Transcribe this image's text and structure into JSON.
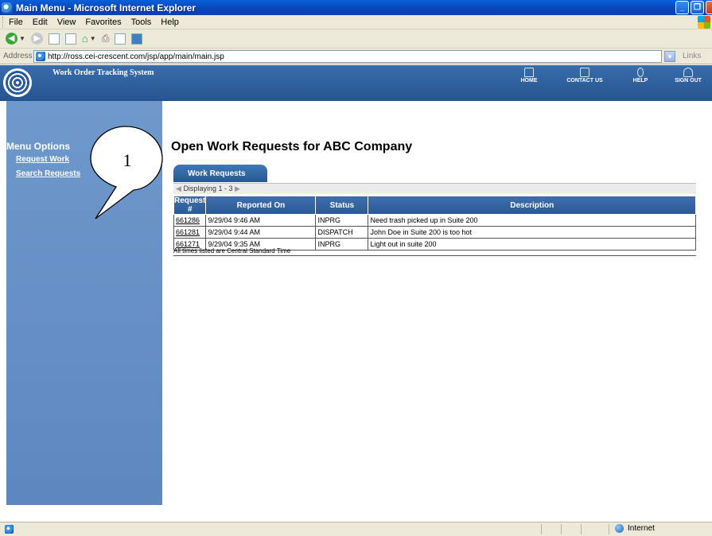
{
  "window": {
    "title": "Main Menu - Microsoft Internet Explorer"
  },
  "menu": [
    "File",
    "Edit",
    "View",
    "Favorites",
    "Tools",
    "Help"
  ],
  "address": {
    "label": "Address",
    "url": "http://ross.cei-crescent.com/jsp/app/main/main.jsp",
    "links_label": "Links"
  },
  "app": {
    "title": "Work Order Tracking System",
    "nav": [
      "HOME",
      "CONTACT US",
      "HELP",
      "SIGN OUT"
    ]
  },
  "sidebar": {
    "heading": "Menu Options",
    "items": [
      {
        "label": "Request Work"
      },
      {
        "label": "Search Requests"
      }
    ]
  },
  "callout": {
    "number": "1"
  },
  "main": {
    "title": "Open Work Requests for ABC Company",
    "tab": "Work Requests",
    "displaying": "Displaying 1 - 3",
    "columns": [
      "Request #",
      "Reported On",
      "Status",
      "Description"
    ],
    "rows": [
      {
        "id": "661286",
        "reported": "9/29/04 9:46 AM",
        "status": "INPRG",
        "desc": "Need trash picked up in Suite 200"
      },
      {
        "id": "661281",
        "reported": "9/29/04 9:44 AM",
        "status": "DISPATCH",
        "desc": "John Doe in Suite 200 is too hot"
      },
      {
        "id": "661271",
        "reported": "9/29/04 9:35 AM",
        "status": "INPRG",
        "desc": "Light out in suite 200"
      }
    ],
    "footnote": "All times listed are Central Standard Time"
  },
  "status": {
    "zone": "Internet"
  }
}
